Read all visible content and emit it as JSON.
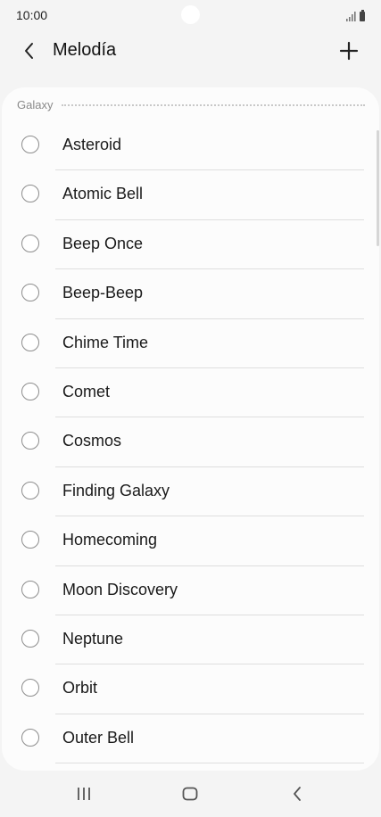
{
  "status_bar": {
    "time": "10:00",
    "icons": [
      "signal-icon",
      "battery-icon"
    ]
  },
  "app_bar": {
    "back_icon": "chevron-left-icon",
    "title": "Melodía",
    "add_icon": "plus-icon"
  },
  "section": {
    "label": "Galaxy"
  },
  "melodies": [
    {
      "label": "Asteroid",
      "selected": false
    },
    {
      "label": "Atomic Bell",
      "selected": false
    },
    {
      "label": "Beep Once",
      "selected": false
    },
    {
      "label": "Beep-Beep",
      "selected": false
    },
    {
      "label": "Chime Time",
      "selected": false
    },
    {
      "label": "Comet",
      "selected": false
    },
    {
      "label": "Cosmos",
      "selected": false
    },
    {
      "label": "Finding Galaxy",
      "selected": false
    },
    {
      "label": "Homecoming",
      "selected": false
    },
    {
      "label": "Moon Discovery",
      "selected": false
    },
    {
      "label": "Neptune",
      "selected": false
    },
    {
      "label": "Orbit",
      "selected": false
    },
    {
      "label": "Outer Bell",
      "selected": false
    }
  ],
  "nav_bar": {
    "icons": [
      "recent-apps-icon",
      "home-icon",
      "back-icon"
    ]
  }
}
